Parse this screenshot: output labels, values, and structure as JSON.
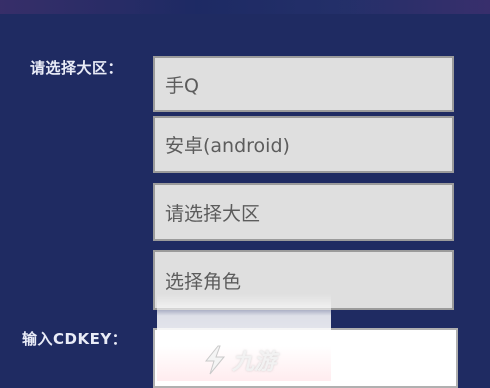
{
  "form": {
    "region_label": "请选择大区：",
    "cdkey_label": "输入CDKEY：",
    "selects": {
      "platform_value": "手Q",
      "os_value": "安卓(android)",
      "region_value": "请选择大区",
      "role_value": "选择角色"
    },
    "cdkey_input_value": ""
  },
  "watermark": {
    "text": "九游"
  }
}
